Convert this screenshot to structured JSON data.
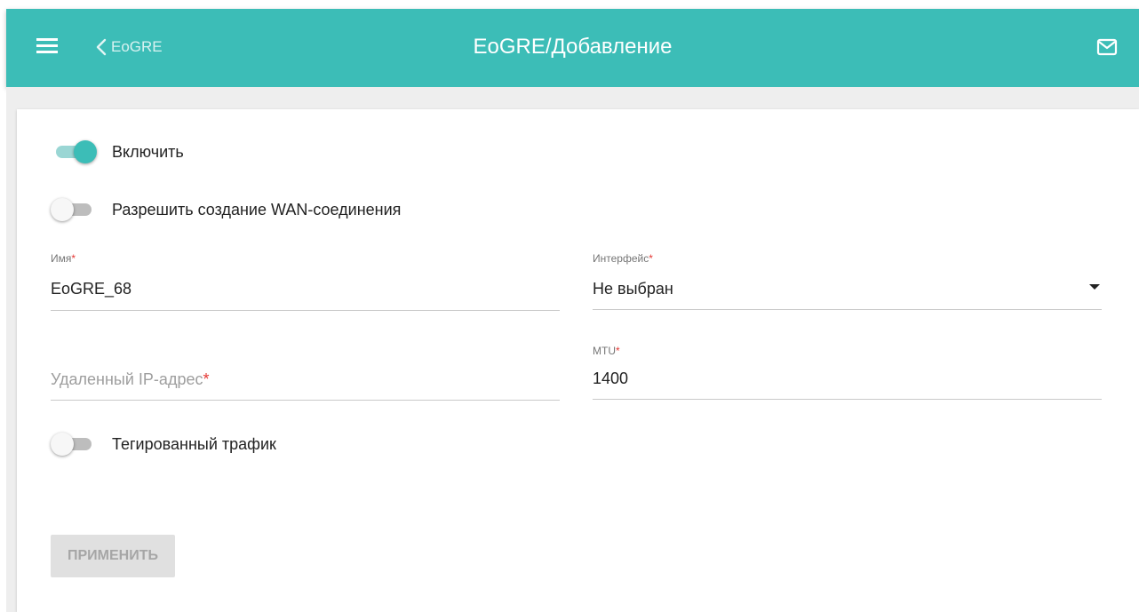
{
  "header": {
    "back_label": "EoGRE",
    "title": "EoGRE/Добавление",
    "color": "#3cbdb7"
  },
  "icons": [
    "menu-icon",
    "chevron-left-icon",
    "mail-icon",
    "dropdown-arrow-icon"
  ],
  "form": {
    "enable": {
      "label": "Включить",
      "checked": true
    },
    "allow_wan": {
      "label": "Разрешить создание WAN-соединения",
      "checked": false
    },
    "name": {
      "label": "Имя",
      "required_mark": "*",
      "value": "EoGRE_68"
    },
    "interface": {
      "label": "Интерфейс",
      "required_mark": "*",
      "value": "Не выбран"
    },
    "remote_ip": {
      "placeholder": "Удаленный IP-адрес",
      "required_mark": "*",
      "value": ""
    },
    "mtu": {
      "label": "MTU",
      "required_mark": "*",
      "value": "1400"
    },
    "tagged_traffic": {
      "label": "Тегированный трафик",
      "checked": false
    }
  },
  "actions": {
    "apply_label": "ПРИМЕНИТЬ",
    "apply_enabled": false
  }
}
